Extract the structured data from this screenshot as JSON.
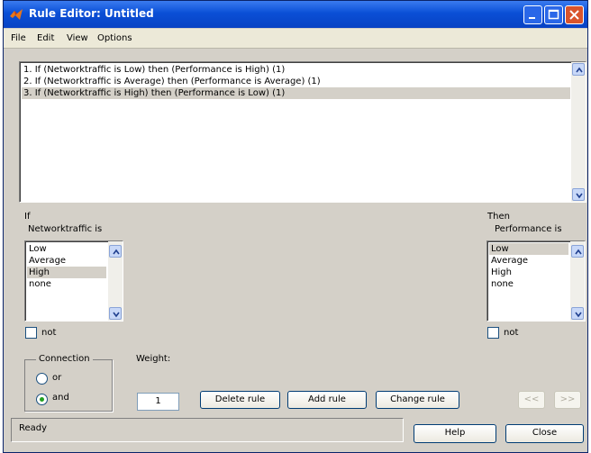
{
  "window": {
    "title": "Rule Editor: Untitled"
  },
  "menu": [
    "File",
    "Edit",
    "View",
    "Options"
  ],
  "rules": {
    "items": [
      "1. If (Networktraffic is Low) then (Performance is High) (1)",
      "2. If (Networktraffic is Average) then (Performance is Average) (1)",
      "3. If (Networktraffic is High) then (Performance is Low) (1)"
    ],
    "selected_index": 2
  },
  "input": {
    "if_label": "If",
    "var_label": "Networktraffic is",
    "options": [
      "Low",
      "Average",
      "High",
      "none"
    ],
    "selected": "High",
    "not_label": "not"
  },
  "output": {
    "then_label": "Then",
    "var_label": "Performance is",
    "options": [
      "Low",
      "Average",
      "High",
      "none"
    ],
    "selected": "Low",
    "not_label": "not"
  },
  "connection": {
    "title": "Connection",
    "options": [
      "or",
      "and"
    ],
    "selected": "and"
  },
  "weight": {
    "label": "Weight:",
    "value": "1"
  },
  "buttons": {
    "delete": "Delete rule",
    "add": "Add rule",
    "change": "Change rule",
    "prev": "<<",
    "next": ">>",
    "help": "Help",
    "close": "Close"
  },
  "status": {
    "text": "Ready"
  },
  "colors": {
    "titlebar": "#0a4fd6",
    "panel": "#d4d0c8",
    "selection": "#d4d0c8"
  }
}
